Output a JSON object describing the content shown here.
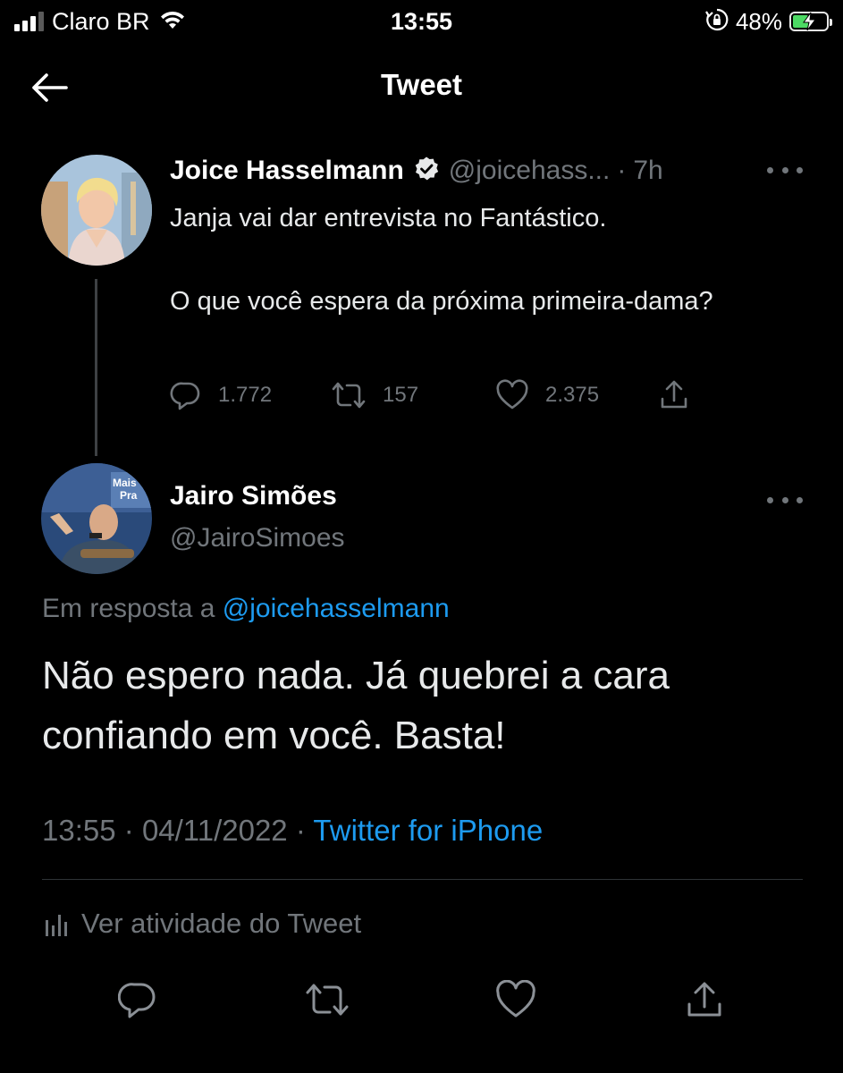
{
  "status_bar": {
    "carrier": "Claro BR",
    "time": "13:55",
    "battery_percent": "48%",
    "battery_level": 0.48,
    "icons": [
      "signal-icon",
      "wifi-icon",
      "orientation-lock-icon",
      "battery-charging-icon"
    ]
  },
  "header": {
    "title": "Tweet",
    "back_icon": "arrow-left-icon"
  },
  "parent_tweet": {
    "name": "Joice Hasselmann",
    "verified": true,
    "handle": "@joicehass...",
    "separator": "·",
    "time_ago": "7h",
    "text_line1": "Janja vai dar entrevista no Fantástico.",
    "text_line2": "O que você espera da próxima primeira-dama?",
    "replies": "1.772",
    "retweets": "157",
    "likes": "2.375"
  },
  "reply_tweet": {
    "name": "Jairo Simões",
    "handle": "@JairoSimoes",
    "replying_prefix": "Em resposta a",
    "replying_to": "@joicehasselmann",
    "text": "Não espero nada. Já quebrei a cara confiando em você. Basta!",
    "time": "13:55",
    "separator": "·",
    "date": "04/11/2022",
    "separator2": "·",
    "source": "Twitter for iPhone",
    "activity_label": "Ver atividade do Tweet"
  },
  "colors": {
    "background": "#000000",
    "text": "#e7e9ea",
    "secondary": "#71767b",
    "accent": "#1d9bf0",
    "divider": "#2f3336",
    "battery": "#4cd964"
  }
}
